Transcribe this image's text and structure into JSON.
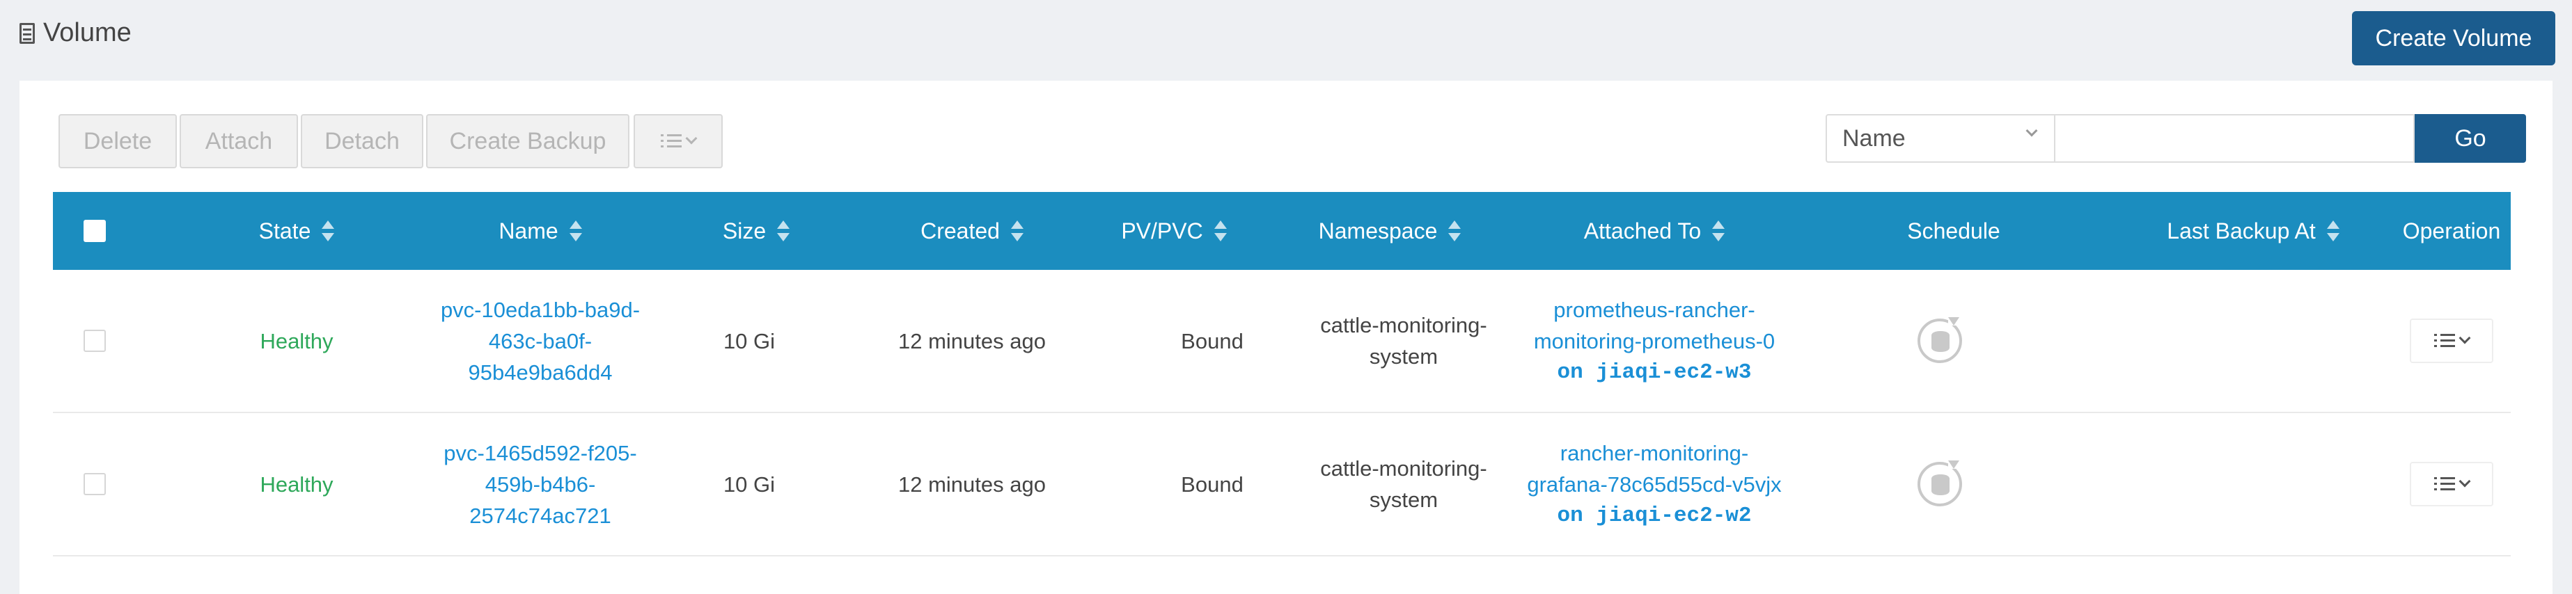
{
  "header": {
    "title": "Volume",
    "create_label": "Create Volume"
  },
  "toolbar": {
    "delete_label": "Delete",
    "attach_label": "Attach",
    "detach_label": "Detach",
    "backup_label": "Create Backup",
    "filter_field": "Name",
    "filter_value": "",
    "go_label": "Go"
  },
  "columns": {
    "state": "State",
    "name": "Name",
    "size": "Size",
    "created": "Created",
    "pvpvc": "PV/PVC",
    "namespace": "Namespace",
    "attached": "Attached To",
    "schedule": "Schedule",
    "last_backup": "Last Backup At",
    "operation": "Operation"
  },
  "rows": [
    {
      "state": "Healthy",
      "name": [
        "pvc-10eda1bb-ba9d-",
        "463c-ba0f-",
        "95b4e9ba6dd4"
      ],
      "size": "10 Gi",
      "created": "12 minutes ago",
      "pvpvc": "Bound",
      "namespace": [
        "cattle-monitoring-",
        "system"
      ],
      "attached": [
        "prometheus-rancher-",
        "monitoring-prometheus-0"
      ],
      "node": "on jiaqi-ec2-w3",
      "last_backup": ""
    },
    {
      "state": "Healthy",
      "name": [
        "pvc-1465d592-f205-",
        "459b-b4b6-",
        "2574c74ac721"
      ],
      "size": "10 Gi",
      "created": "12 minutes ago",
      "pvpvc": "Bound",
      "namespace": [
        "cattle-monitoring-",
        "system"
      ],
      "attached": [
        "rancher-monitoring-",
        "grafana-78c65d55cd-v5vjx"
      ],
      "node": "on jiaqi-ec2-w2",
      "last_backup": ""
    }
  ],
  "colors": {
    "primary": "#1b5c8e",
    "table_header": "#1b8dbf",
    "healthy": "#2ea85a",
    "link": "#1a8fd6"
  },
  "icons": {
    "title": "volume-list-icon",
    "bulk_menu": "list-menu-icon",
    "schedule": "recurring-backup-icon",
    "operation": "list-menu-icon"
  }
}
